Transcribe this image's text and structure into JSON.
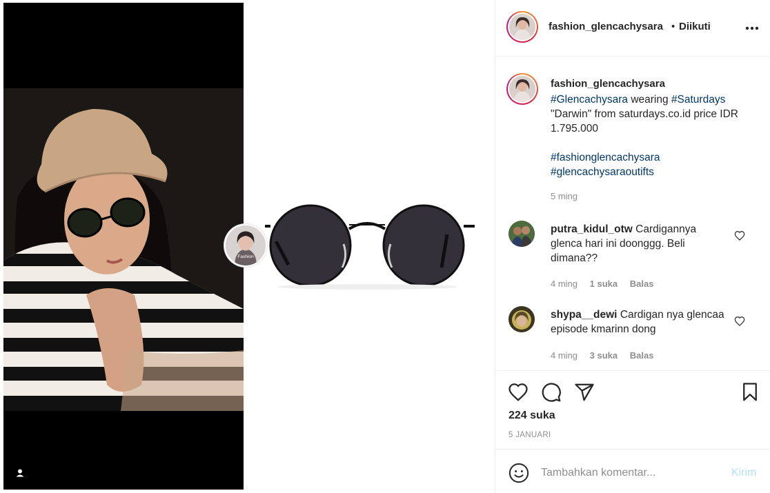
{
  "post": {
    "owner": "fashion_glencachysara",
    "follow_separator": "•",
    "follow_status": "Diikuti",
    "more_icon": "more-horizontal-icon"
  },
  "caption": {
    "username": "fashion_glencachysara",
    "hashtag1": "#Glencachysara",
    "mid_text": " wearing ",
    "hashtag2": "#Saturdays",
    "body": "\"Darwin\" from saturdays.co.id price IDR 1.795.000",
    "hashtag3": "#fashionglencachysara",
    "hashtag4": "#glencachysaraoutifts",
    "time": "5 ming"
  },
  "comments": [
    {
      "username": "putra_kidul_otw",
      "text": "Cardigannya glenca hari ini doonggg. Beli dimana??",
      "time": "4 ming",
      "likes": "1 suka",
      "reply": "Balas"
    },
    {
      "username": "shypa__dewi",
      "text": "Cardigan nya glencaa episode kmarinn dong",
      "time": "4 ming",
      "likes": "3 suka",
      "reply": "Balas"
    }
  ],
  "actions": {
    "like_icon": "heart-icon",
    "comment_icon": "comment-icon",
    "share_icon": "share-icon",
    "save_icon": "bookmark-icon"
  },
  "likes_count": "224 suka",
  "date": "5 JANUARI",
  "add_comment": {
    "placeholder": "Tambahkan komentar...",
    "post_label": "Kirim"
  },
  "media": {
    "tag_label": "Fashion"
  },
  "colors": {
    "hashtag": "#00376b",
    "muted": "#8e8e8e",
    "post_disabled": "#b2dffc",
    "border": "#efefef"
  }
}
